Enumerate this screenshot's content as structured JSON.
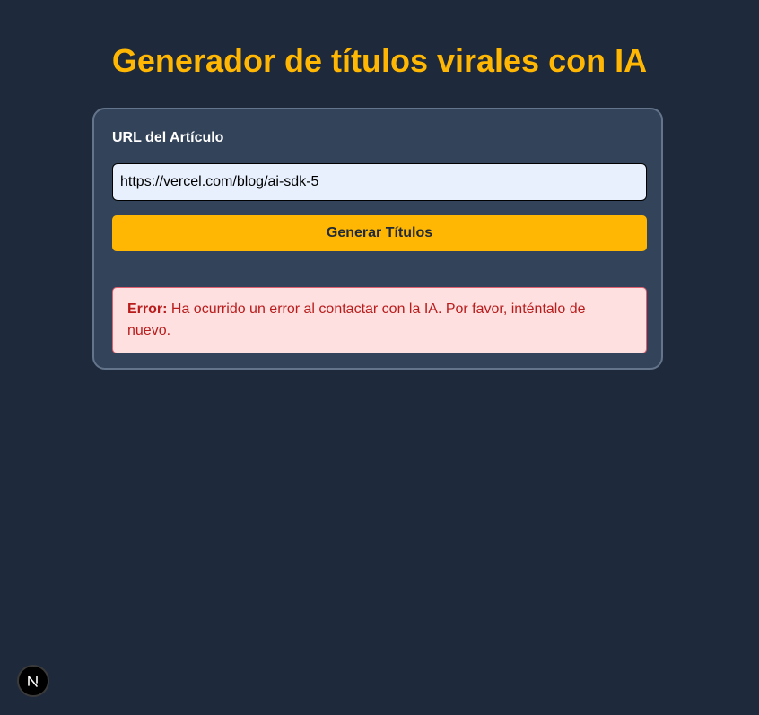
{
  "header": {
    "title": "Generador de títulos virales con IA"
  },
  "form": {
    "url_label": "URL del Artículo",
    "url_value": "https://vercel.com/blog/ai-sdk-5",
    "submit_label": "Generar Títulos"
  },
  "error": {
    "prefix": "Error:",
    "message": "Ha ocurrido un error al contactar con la IA. Por favor, inténtalo de nuevo."
  },
  "dev_badge": {
    "icon": "nextjs-logo-icon",
    "letter": "N"
  },
  "colors": {
    "background": "#1e293b",
    "card": "#334359",
    "accent": "#ffb703",
    "error_bg": "#fee0e0",
    "error_text": "#b91c1c"
  }
}
